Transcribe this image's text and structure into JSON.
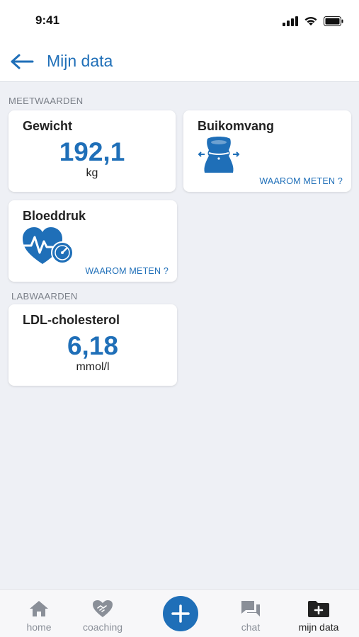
{
  "status": {
    "time": "9:41"
  },
  "header": {
    "title": "Mijn data"
  },
  "sections": {
    "measurements": "MEETWAARDEN",
    "lab": "LABWAARDEN"
  },
  "cards": {
    "weight": {
      "title": "Gewicht",
      "value": "192,1",
      "unit": "kg"
    },
    "waist": {
      "title": "Buikomvang",
      "link": "WAAROM METEN ?",
      "icon": "waist-measure-icon"
    },
    "blood_pressure": {
      "title": "Bloeddruk",
      "link": "WAAROM METEN ?",
      "icon": "heart-pressure-icon"
    },
    "ldl": {
      "title": "LDL-cholesterol",
      "value": "6,18",
      "unit": "mmol/l"
    }
  },
  "tabbar": {
    "home": "home",
    "coaching": "coaching",
    "chat": "chat",
    "mydata": "mijn data",
    "active": "mijn data"
  },
  "colors": {
    "accent": "#1f6fb8",
    "background": "#eef0f5",
    "icon_gray": "#8a8f98"
  }
}
